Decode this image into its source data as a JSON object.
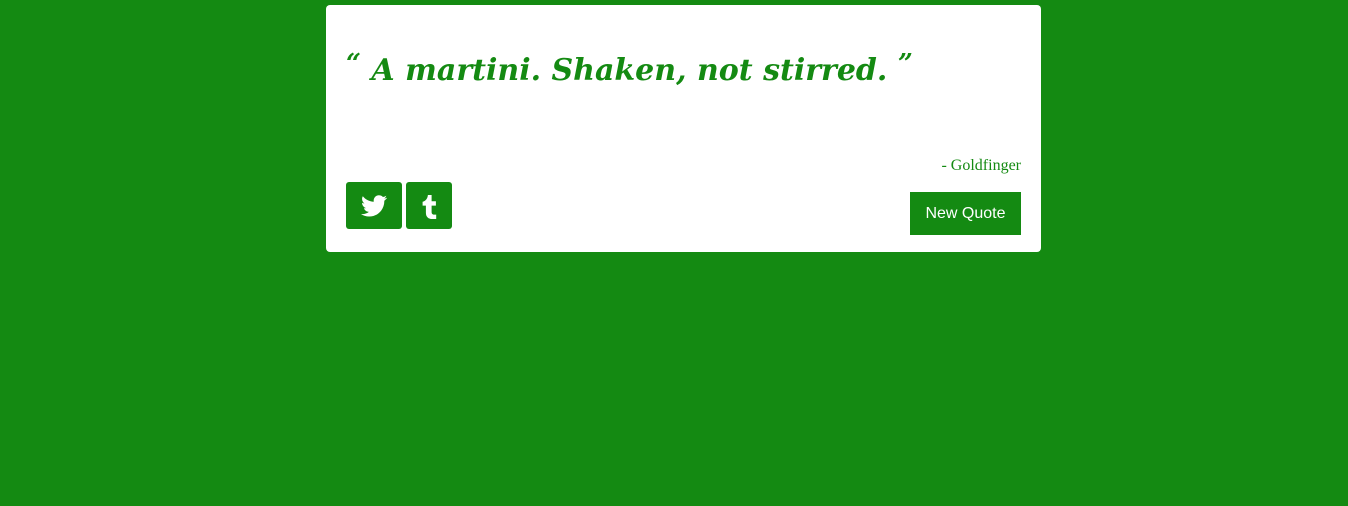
{
  "quote": {
    "open_mark": "“",
    "text": "A martini. Shaken, not stirred.",
    "close_mark": "”",
    "author": "- Goldfinger"
  },
  "buttons": {
    "new_quote_label": "New Quote",
    "twitter_icon": "twitter-icon",
    "tumblr_icon": "tumblr-icon"
  },
  "colors": {
    "background": "#148a12",
    "card": "#ffffff",
    "accent": "#148a12"
  }
}
